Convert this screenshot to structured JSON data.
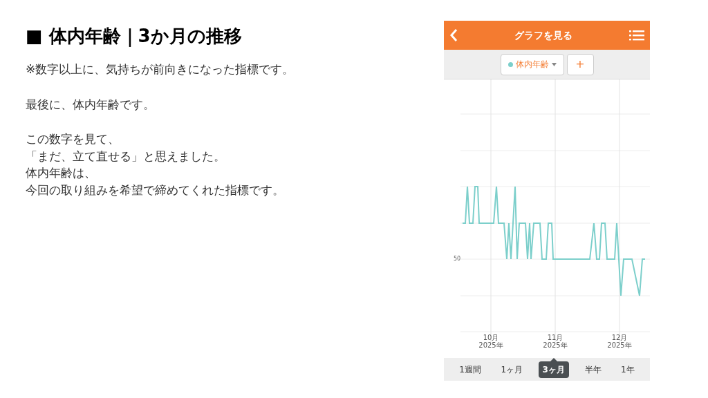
{
  "slide": {
    "title": "■ 体内年齢｜3か月の推移",
    "paragraphs": [
      [
        "※数字以上に、気持ちが前向きになった指標です。"
      ],
      [
        "最後に、体内年齢です。"
      ],
      [
        "この数字を見て、",
        "「まだ、立て直せる」と思えました。",
        "体内年齢は、",
        "今回の取り組みを希望で締めてくれた指標です。"
      ]
    ]
  },
  "app": {
    "header": {
      "title": "グラフを見る"
    },
    "metric_selector": {
      "label": "体内年齢",
      "color": "#7ccfcb"
    },
    "add_button": "+",
    "chart": {
      "y_labels": [
        "50"
      ],
      "x_labels": [
        [
          "10月",
          "2025年"
        ],
        [
          "11月",
          "2025年"
        ],
        [
          "12月",
          "2025年"
        ]
      ]
    },
    "periods": [
      {
        "label": "1週間",
        "selected": false
      },
      {
        "label": "1ヶ月",
        "selected": false
      },
      {
        "label": "3ヶ月",
        "selected": true
      },
      {
        "label": "半年",
        "selected": false
      },
      {
        "label": "1年",
        "selected": false
      }
    ]
  }
}
